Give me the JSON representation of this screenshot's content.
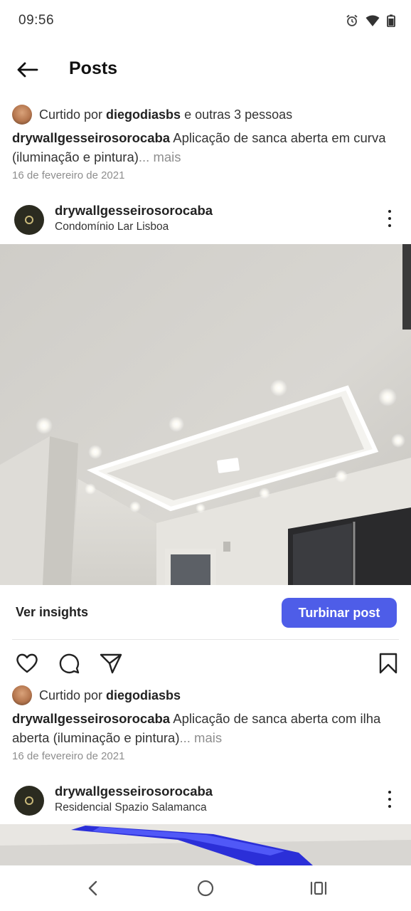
{
  "status_bar": {
    "time": "09:56",
    "icons": [
      "alarm-icon",
      "wifi-icon",
      "battery-icon"
    ]
  },
  "header": {
    "title": "Posts",
    "back_icon": "arrow-left-icon"
  },
  "post1": {
    "liked_prefix": "Curtido por",
    "liked_user": "diegodiasbs",
    "liked_suffix": "e outras 3 pessoas",
    "caption_user": "drywallgesseirosorocaba",
    "caption_text": " Aplicação de sanca aberta em curva (iluminação e pintura)",
    "caption_more": "... mais",
    "date": "16 de fevereiro de 2021"
  },
  "post2": {
    "username": "drywallgesseirosorocaba",
    "location": "Condomínio Lar Lisboa",
    "insights_label": "Ver insights",
    "boost_label": "Turbinar post",
    "liked_prefix": "Curtido por",
    "liked_user": "diegodiasbs",
    "caption_user": "drywallgesseirosorocaba",
    "caption_text": " Aplicação de sanca aberta com ilha aberta (iluminação e pintura)",
    "caption_more": "... mais",
    "date": "16 de fevereiro de 2021"
  },
  "post3": {
    "username": "drywallgesseirosorocaba",
    "location": "Residencial Spazio Salamanca"
  },
  "colors": {
    "accent": "#4e5de8",
    "muted": "#8e8e8e",
    "text": "#262626"
  },
  "nav": {
    "icons": [
      "back-nav-icon",
      "home-nav-icon",
      "recents-nav-icon"
    ]
  }
}
